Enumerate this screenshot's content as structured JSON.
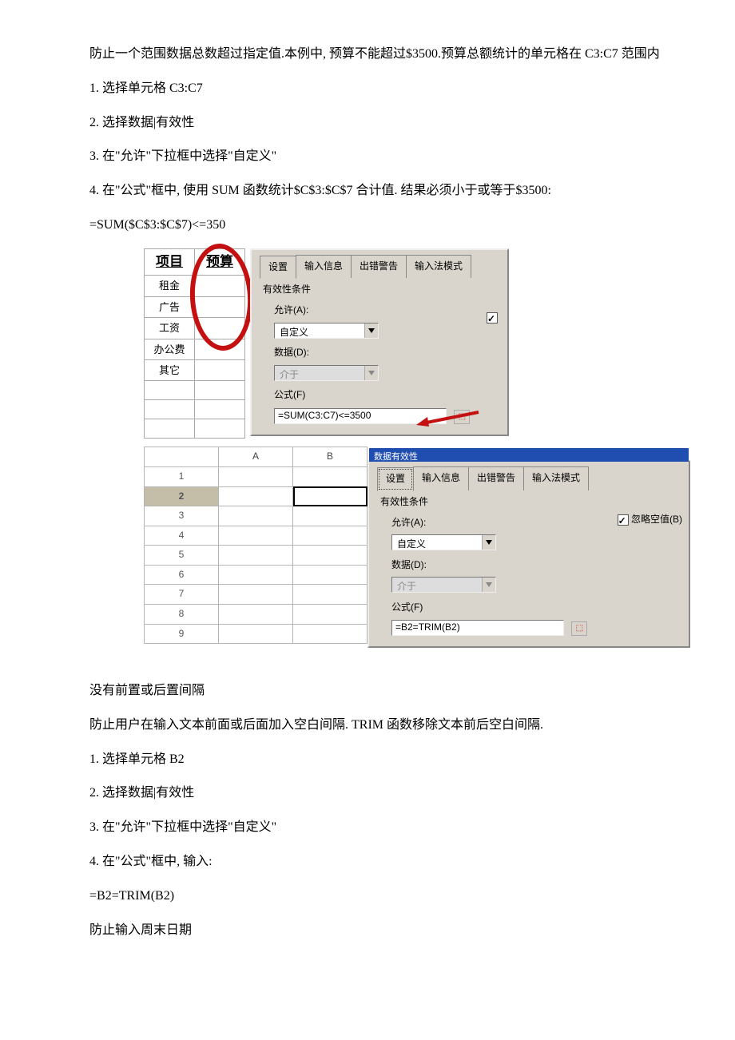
{
  "intro": "防止一个范围数据总数超过指定值.本例中, 预算不能超过$3500.预算总额统计的单元格在 C3:C7 范围内",
  "steps1": {
    "s1": "1. 选择单元格 C3:C7",
    "s2": "2. 选择数据|有效性",
    "s3": "3. 在\"允许\"下拉框中选择\"自定义\"",
    "s4": "4. 在\"公式\"框中, 使用 SUM 函数统计$C$3:$C$7 合计值. 结果必须小于或等于$3500:"
  },
  "formula1": " =SUM($C$3:$C$7)<=350",
  "fig1": {
    "col_header": {
      "a": "项目",
      "b": "预算"
    },
    "rows": [
      "租金",
      "广告",
      "工资",
      "办公费",
      "其它"
    ],
    "tabs": {
      "t1": "设置",
      "t2": "输入信息",
      "t3": "出错警告",
      "t4": "输入法模式"
    },
    "labels": {
      "section": "有效性条件",
      "allow": "允许(A):",
      "allow_value": "自定义",
      "data": "数据(D):",
      "data_value": "介于",
      "formula": "公式(F)",
      "formula_value": "=SUM(C3:C7)<=3500"
    }
  },
  "fig2": {
    "titlebar": "数据有效性",
    "col_headers": {
      "corner": "",
      "a": "A",
      "b": "B"
    },
    "row_numbers": [
      "1",
      "2",
      "3",
      "4",
      "5",
      "6",
      "7",
      "8",
      "9"
    ],
    "tabs": {
      "t1": "设置",
      "t2": "输入信息",
      "t3": "出错警告",
      "t4": "输入法模式"
    },
    "labels": {
      "section": "有效性条件",
      "allow": "允许(A):",
      "allow_value": "自定义",
      "data": "数据(D):",
      "data_value": "介于",
      "formula": "公式(F)",
      "formula_value": "=B2=TRIM(B2)",
      "ignore_blank": "忽略空值(B)"
    }
  },
  "section2": {
    "title": "没有前置或后置间隔",
    "desc": "防止用户在输入文本前面或后面加入空白间隔. TRIM 函数移除文本前后空白间隔.",
    "s1": "1. 选择单元格 B2",
    "s2": "2. 选择数据|有效性",
    "s3": "3. 在\"允许\"下拉框中选择\"自定义\"",
    "s4": "4. 在\"公式\"框中, 输入:",
    "formula": " =B2=TRIM(B2)",
    "last": "防止输入周末日期"
  }
}
